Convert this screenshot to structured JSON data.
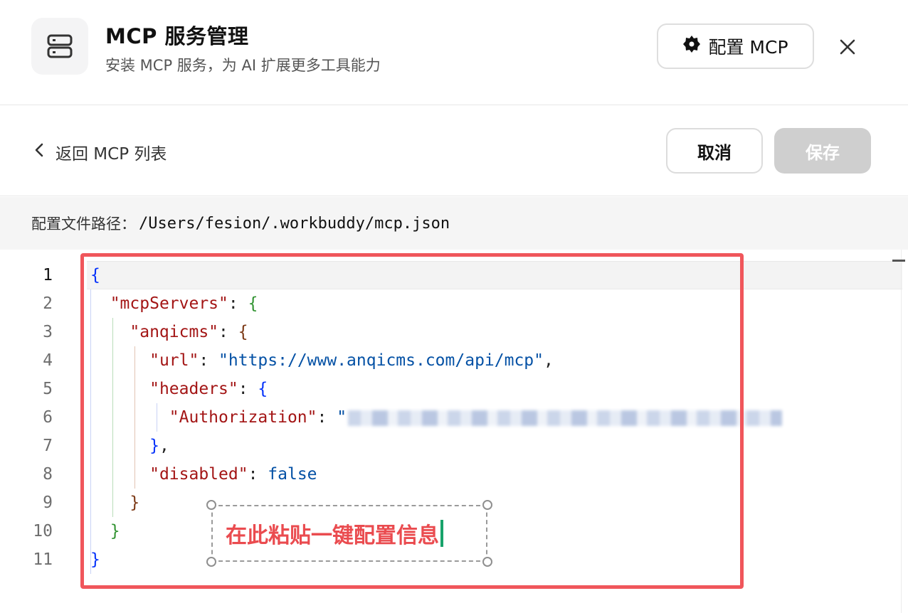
{
  "header": {
    "title": "MCP 服务管理",
    "subtitle": "安装 MCP 服务，为 AI 扩展更多工具能力",
    "icon": "server-icon",
    "config_button_label": "配置 MCP",
    "config_button_icon": "gear-icon",
    "close_icon": "close-icon"
  },
  "toolbar": {
    "back_label": "返回 MCP 列表",
    "back_icon": "chevron-left-icon",
    "cancel_label": "取消",
    "save_label": "保存"
  },
  "path": {
    "label": "配置文件路径：",
    "value": "/Users/fesion/.workbuddy/mcp.json"
  },
  "editor": {
    "line_numbers": [
      "1",
      "2",
      "3",
      "4",
      "5",
      "6",
      "7",
      "8",
      "9",
      "10",
      "11"
    ],
    "active_line": 1,
    "tokens": {
      "mcp_servers_key": "\"mcpServers\"",
      "server_key": "\"anqicms\"",
      "url_key": "\"url\"",
      "url_value": "\"https://www.anqicms.com/api/mcp\"",
      "headers_key": "\"headers\"",
      "authorization_key": "\"Authorization\"",
      "authorization_quote": "\"",
      "disabled_key": "\"disabled\"",
      "disabled_value": "false"
    }
  },
  "annotation": {
    "callout_text": "在此粘贴一键配置信息",
    "highlight_color": "#f0565b"
  }
}
